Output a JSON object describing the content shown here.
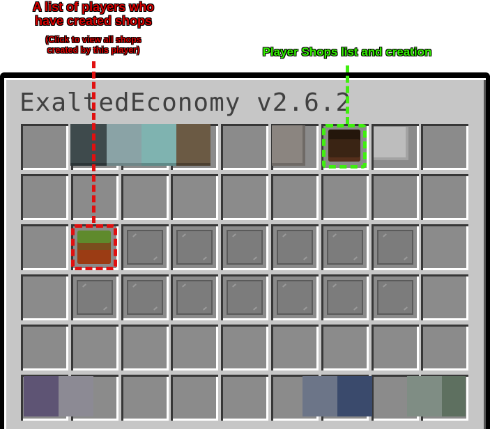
{
  "annotations": {
    "red_title_lines": [
      "A list of players who",
      "have created shops"
    ],
    "red_sub_lines": [
      "(Click to view all shops",
      "created by this player)"
    ],
    "green_label": "Player Shops list and creation"
  },
  "window": {
    "title": "ExaltedEconomy v2.6.2"
  },
  "grid": {
    "rows": 6,
    "columns": 9
  },
  "items": [
    {
      "name": "dark-teal-block",
      "color": "#3e4a4c"
    },
    {
      "name": "light-teal-block",
      "color": "#8aa3a6"
    },
    {
      "name": "aqua-block",
      "color": "#7fb3b0"
    },
    {
      "name": "brown-block",
      "color": "#6b5a44"
    },
    {
      "name": "gray-stone-block",
      "color": "#8b8580"
    },
    {
      "name": "player-shops-head",
      "color": "#3a2414"
    },
    {
      "name": "light-gray-block",
      "color": "#bdbdbd"
    },
    {
      "name": "player-head-shop-owner",
      "color": "#5f8a2c"
    }
  ],
  "colors": {
    "annotation_red": "#d90000",
    "annotation_green": "#33ee00",
    "window_bg": "#c6c6c6",
    "slot_bg": "#8b8b8b"
  }
}
